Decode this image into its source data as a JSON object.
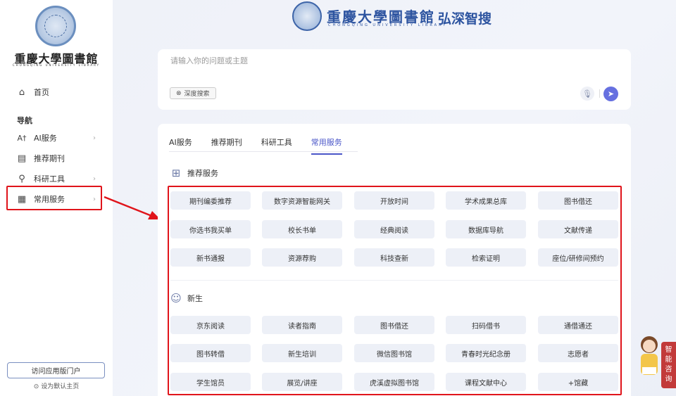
{
  "sidebar": {
    "library_name": "重慶大學圖書館",
    "library_name_en": "CHONGQING UNIVERSITY LIBRARY",
    "home_label": "首页",
    "nav_heading": "导航",
    "items": [
      {
        "label": "AI服务",
        "icon": "ai-icon"
      },
      {
        "label": "推荐期刊",
        "icon": "journal-icon"
      },
      {
        "label": "科研工具",
        "icon": "microscope-icon"
      },
      {
        "label": "常用服务",
        "icon": "apps-grid-icon"
      }
    ],
    "visit_app": "访问应用版门户",
    "set_default": "设为默认主页"
  },
  "header": {
    "library_name": "重慶大學圖書館",
    "library_name_en": "CHONGQING UNIVERSITY LIBRARY",
    "product_name": "弘深智搜"
  },
  "search": {
    "placeholder": "请输入你的问题或主题",
    "deep_search_label": "深度搜索"
  },
  "tabs": [
    {
      "label": "AI服务",
      "active": false
    },
    {
      "label": "推荐期刊",
      "active": false
    },
    {
      "label": "科研工具",
      "active": false
    },
    {
      "label": "常用服务",
      "active": true
    }
  ],
  "sections": [
    {
      "title": "推荐服务",
      "icon": "grid-apps-icon",
      "items": [
        "期刊编委推荐",
        "数字资源智能网关",
        "开放时间",
        "学术成果总库",
        "图书借还",
        "你选书我买单",
        "校长书单",
        "经典阅读",
        "数据库导航",
        "文献传递",
        "新书通报",
        "资源荐购",
        "科技查新",
        "检索证明",
        "座位/研修间预约"
      ]
    },
    {
      "title": "新生",
      "icon": "student-icon",
      "items": [
        "京东阅读",
        "读者指南",
        "图书借还",
        "扫码借书",
        "通借通还",
        "图书转借",
        "新生培训",
        "微信图书馆",
        "青春时光纪念册",
        "志愿者",
        "学生馆员",
        "展览/讲座",
        "虎溪虚拟图书馆",
        "课程文献中心",
        "+馆藏"
      ]
    }
  ],
  "assistant": {
    "label_chars": [
      "智",
      "能",
      "咨",
      "询"
    ]
  },
  "colors": {
    "accent": "#4a56c8",
    "brand": "#2d54a0",
    "highlight_red": "#e0141b",
    "chip_bg": "#edf0f7"
  }
}
